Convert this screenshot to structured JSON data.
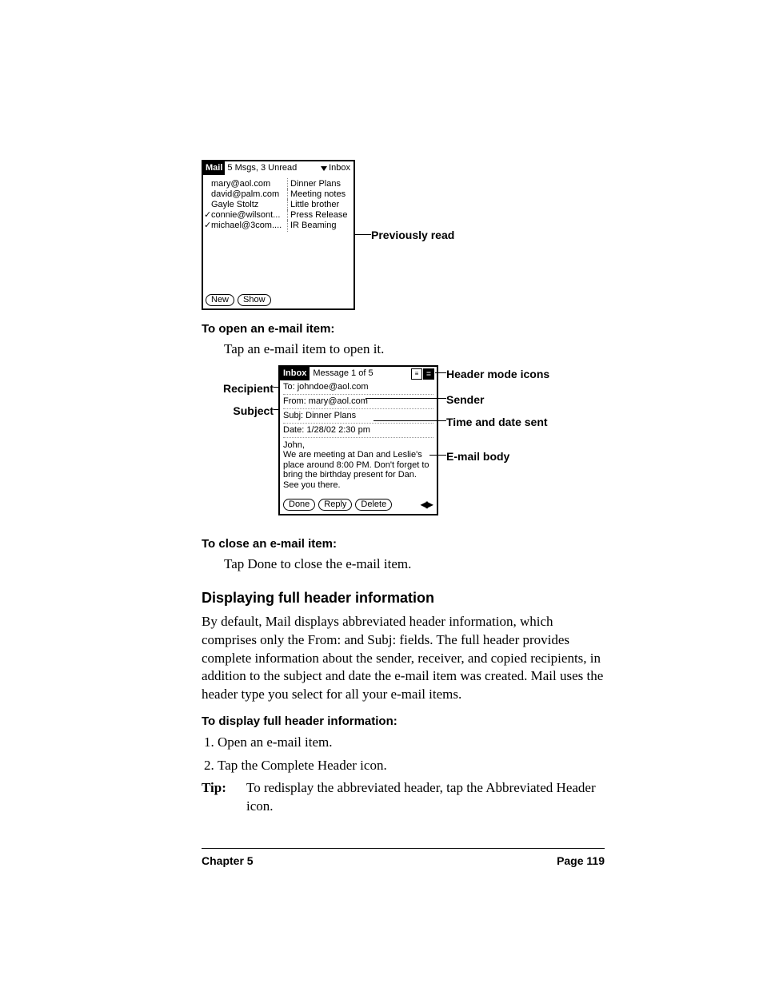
{
  "fig1": {
    "app_title": "Mail",
    "status": "5 Msgs, 3 Unread",
    "folder": "Inbox",
    "rows": [
      {
        "read": false,
        "sender": "mary@aol.com",
        "subject": "Dinner Plans"
      },
      {
        "read": false,
        "sender": "david@palm.com",
        "subject": "Meeting notes"
      },
      {
        "read": false,
        "sender": "Gayle Stoltz",
        "subject": "Little brother"
      },
      {
        "read": true,
        "sender": "connie@wilsont...",
        "subject": "Press Release"
      },
      {
        "read": true,
        "sender": "michael@3com....",
        "subject": "IR Beaming"
      }
    ],
    "btn_new": "New",
    "btn_show": "Show",
    "callout": "Previously read"
  },
  "fig2": {
    "app_title": "Inbox",
    "status": "Message 1 of 5",
    "to": "To: johndoe@aol.com",
    "from": "From: mary@aol.com",
    "subj": "Subj: Dinner Plans",
    "date": "Date: 1/28/02 2:30 pm",
    "body": "John,\nWe are meeting at Dan and Leslie's place around 8:00 PM. Don't forget to bring the birthday present for Dan. See you there.",
    "btn_done": "Done",
    "btn_reply": "Reply",
    "btn_delete": "Delete",
    "labels": {
      "recipient": "Recipient",
      "subject": "Subject",
      "header_icons": "Header mode icons",
      "sender": "Sender",
      "datetime": "Time and date sent",
      "body": "E-mail body"
    }
  },
  "text": {
    "h_open": "To open an e-mail item:",
    "p_open": "Tap an e-mail item to open it.",
    "h_close": "To close an e-mail item:",
    "p_close": "Tap Done to close the e-mail item.",
    "h_full": "Displaying full header information",
    "p_full": "By default, Mail displays abbreviated header information, which comprises only the From: and Subj: fields. The full header provides complete information about the sender, receiver, and copied recipients, in addition to the subject and date the e-mail item was created. Mail uses the header type you select for all your e-mail items.",
    "h_display": "To display full header information:",
    "step1": "Open an e-mail item.",
    "step2": "Tap the Complete Header icon.",
    "tip_label": "Tip:",
    "tip_body": "To redisplay the abbreviated header, tap the Abbreviated Header icon."
  },
  "footer": {
    "left": "Chapter 5",
    "right": "Page 119"
  }
}
